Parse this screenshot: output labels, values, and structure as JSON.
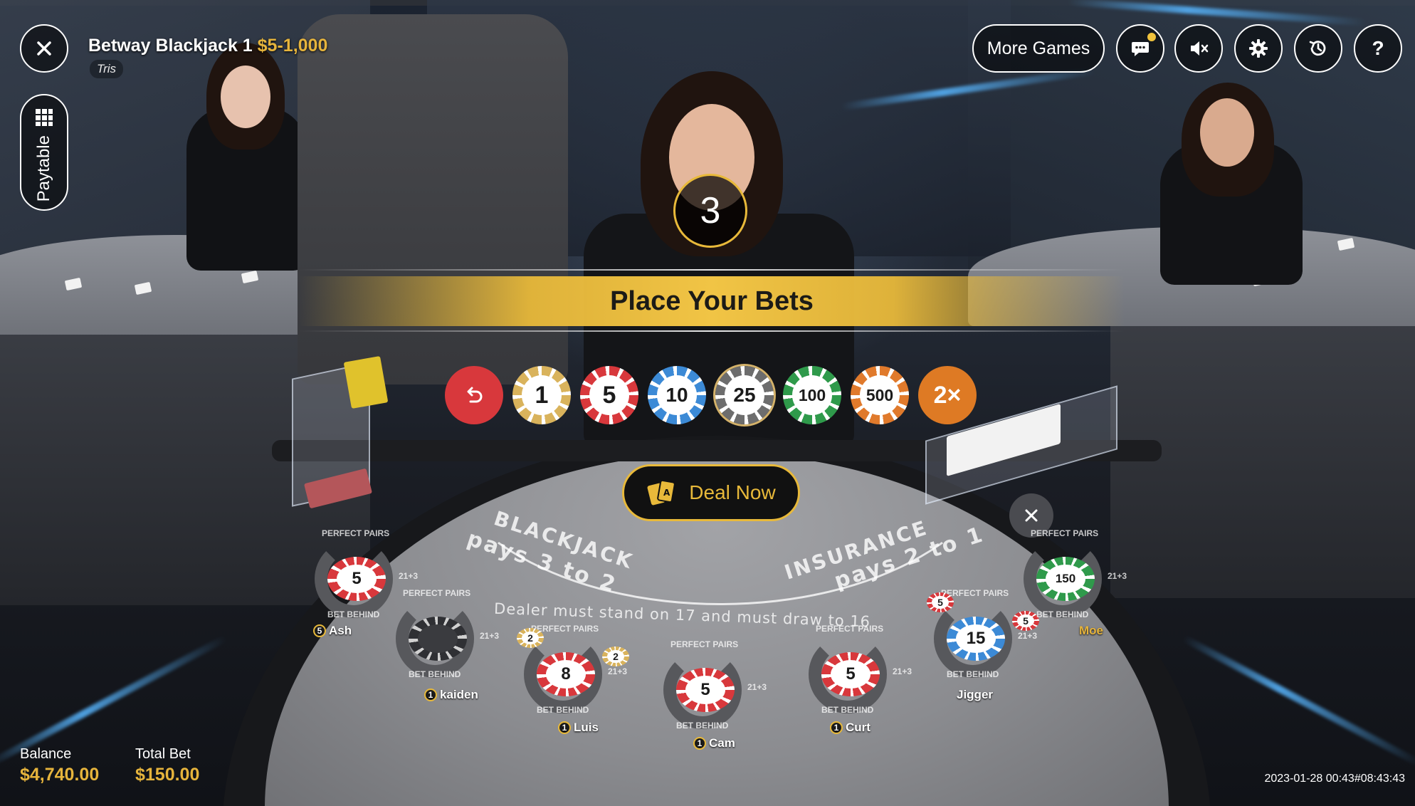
{
  "header": {
    "table_name": "Betway Blackjack 1",
    "limits": "$5-1,000",
    "dealer": "Tris"
  },
  "controls": {
    "more_games": "More Games",
    "paytable": "Paytable",
    "help": "?"
  },
  "round": {
    "timer": "3",
    "banner": "Place Your Bets",
    "deal_now": "Deal Now"
  },
  "chips": [
    {
      "value": "1",
      "color": "#d9b35c"
    },
    {
      "value": "5",
      "color": "#d8383c"
    },
    {
      "value": "10",
      "color": "#3c8ad6"
    },
    {
      "value": "25",
      "color": "#6d6d6d"
    },
    {
      "value": "100",
      "color": "#2f9a4b"
    },
    {
      "value": "500",
      "color": "#e07a2c"
    }
  ],
  "double_label": "2×",
  "table_felt": {
    "blackjack_line1": "BLACKJACK",
    "blackjack_line2": "pays 3 to 2",
    "insurance_line1": "INSURANCE",
    "insurance_line2": "pays 2 to 1",
    "dealer_rule": "Dealer must stand on 17 and must draw to 16"
  },
  "ring_labels": {
    "perfect_pairs": "PERFECT PAIRS",
    "bet_behind": "BET BEHIND",
    "side_21_3": "21+3"
  },
  "seats": [
    {
      "name": "Ash",
      "badge": "5",
      "bet": "5",
      "chip_color": "#d8383c"
    },
    {
      "name": "kaiden",
      "badge": "1",
      "bet": "",
      "chip_color": "#3a3b3f"
    },
    {
      "name": "Luis",
      "badge": "1",
      "bet": "8",
      "chip_color": "#d8383c",
      "side_a": "2",
      "side_b": "2"
    },
    {
      "name": "Cam",
      "badge": "1",
      "bet": "5",
      "chip_color": "#d8383c"
    },
    {
      "name": "Curt",
      "badge": "1",
      "bet": "5",
      "chip_color": "#d8383c"
    },
    {
      "name": "Jigger",
      "badge": "",
      "bet": "15",
      "chip_color": "#3c8ad6",
      "side_a": "5",
      "side_b": "5"
    },
    {
      "name": "Moe",
      "badge": "",
      "bet": "150",
      "chip_color": "#2f9a4b"
    }
  ],
  "footer": {
    "balance_label": "Balance",
    "balance_value": "$4,740.00",
    "total_bet_label": "Total Bet",
    "total_bet_value": "$150.00",
    "timestamp": "2023-01-28 00:43#08:43:43"
  },
  "colors": {
    "accent_gold": "#e8b93a",
    "undo_red": "#d8383c",
    "double_orange": "#de7a24"
  }
}
